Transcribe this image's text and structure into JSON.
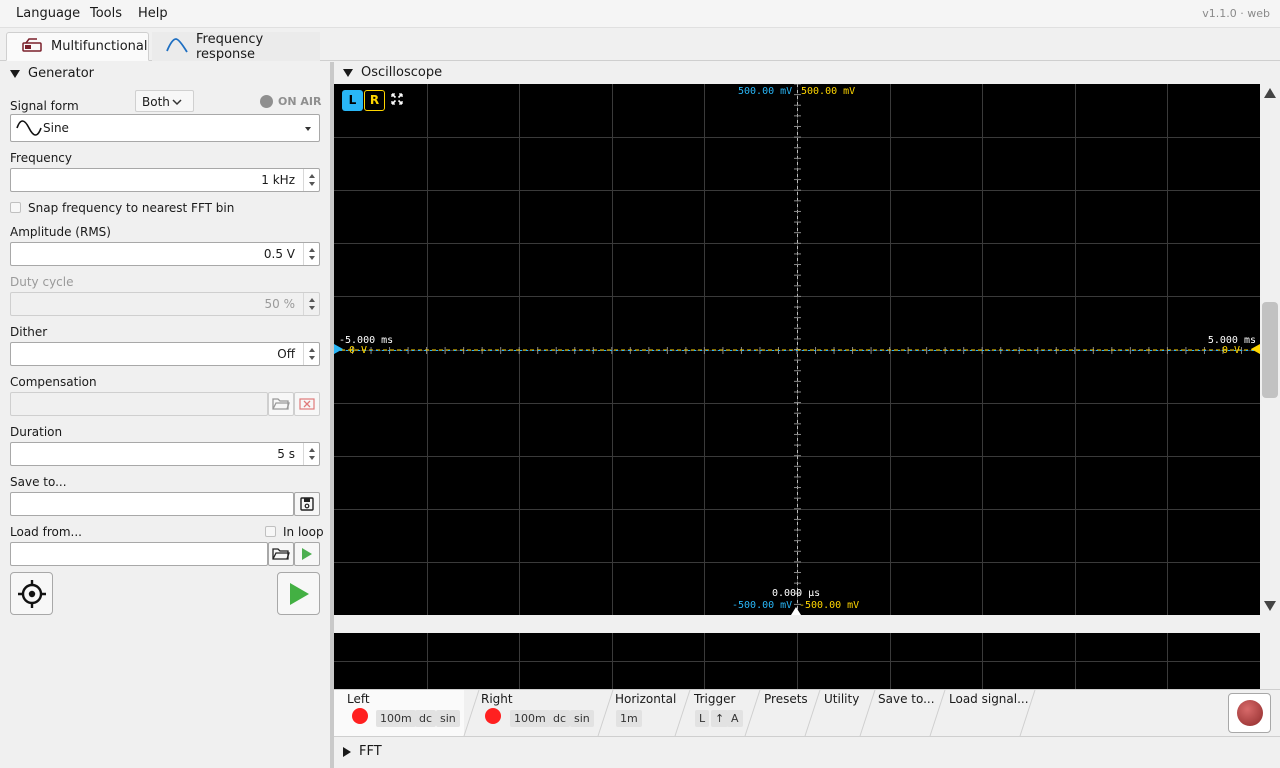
{
  "menu": {
    "items": [
      "Language",
      "Tools",
      "Help"
    ],
    "version": "v1.1.0 · web"
  },
  "tabs": [
    {
      "label": "Multifunctional",
      "icon": "generator-icon",
      "active": true
    },
    {
      "label": "Frequency response",
      "icon": "freq-response-icon",
      "active": false
    }
  ],
  "generator": {
    "title": "Generator",
    "signal_form_label": "Signal form",
    "channel_select": "Both",
    "on_air": "ON AIR",
    "signal_form": "Sine",
    "frequency_label": "Frequency",
    "frequency": "1 kHz",
    "snap_label": "Snap frequency to nearest FFT bin",
    "amplitude_label": "Amplitude (RMS)",
    "amplitude": "0.5 V",
    "duty_label": "Duty cycle",
    "duty": "50 %",
    "dither_label": "Dither",
    "dither": "Off",
    "compensation_label": "Compensation",
    "compensation": "",
    "duration_label": "Duration",
    "duration": "5 s",
    "save_label": "Save to...",
    "save_path": "",
    "load_label": "Load from...",
    "load_path": "",
    "in_loop_label": "In loop"
  },
  "oscilloscope": {
    "title": "Oscilloscope",
    "ch_left": "L",
    "ch_right": "R",
    "top_left_scale": "500.00 mV",
    "top_right_scale": "500.00 mV",
    "bottom_left_scale": "-500.00 mV",
    "bottom_right_scale": "-500.00 mV",
    "time_left": "-5.000 ms",
    "time_right": "5.000 ms",
    "time_center": "0.000 µs",
    "zero_left": "0 V",
    "zero_right": "0 V",
    "colors": {
      "left": "#29b6f6",
      "right": "#ffd600",
      "grid": "#3a3a3a"
    }
  },
  "controls": {
    "left": {
      "title": "Left",
      "range": "100m",
      "coupling": "dc",
      "mode": "sin"
    },
    "right": {
      "title": "Right",
      "range": "100m",
      "coupling": "dc",
      "mode": "sin"
    },
    "horizontal": {
      "title": "Horizontal",
      "value": "1m"
    },
    "trigger": {
      "title": "Trigger",
      "ch": "L",
      "edge": "↑",
      "mode": "A"
    },
    "presets": "Presets",
    "utility": "Utility",
    "save": "Save to...",
    "load": "Load signal..."
  },
  "fft": {
    "title": "FFT"
  }
}
